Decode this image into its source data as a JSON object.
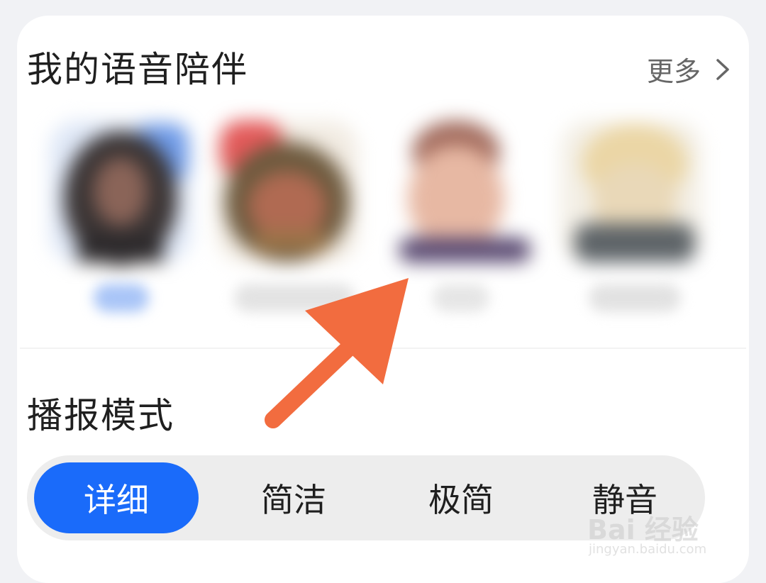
{
  "voice_companion": {
    "title": "我的语音陪伴",
    "more_label": "更多",
    "avatars": [
      {
        "name": "",
        "selected": true
      },
      {
        "name": "",
        "selected": false
      },
      {
        "name": "",
        "selected": false
      },
      {
        "name": "",
        "selected": false
      }
    ]
  },
  "broadcast_mode": {
    "title": "播报模式",
    "options": [
      "详细",
      "简洁",
      "极简",
      "静音"
    ],
    "selected": "详细"
  },
  "watermark": {
    "text": "Bai 经验",
    "sub": "jingyan.baidu.com"
  },
  "colors": {
    "accent": "#1a6bfa",
    "annotation_arrow": "#f26c3f"
  }
}
